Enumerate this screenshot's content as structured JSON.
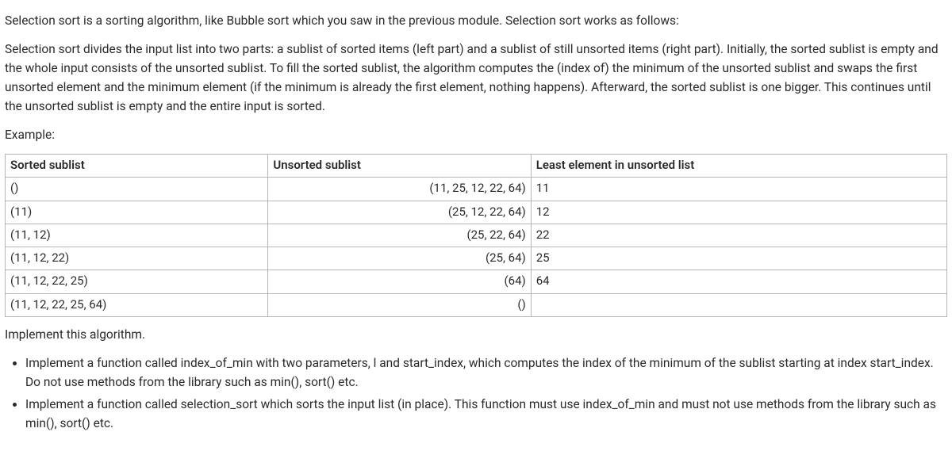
{
  "intro1": "Selection sort is a sorting algorithm, like Bubble sort which you saw in the previous module. Selection sort works as follows:",
  "intro2": "Selection sort divides the input list into two parts: a sublist of sorted items (left part) and a sublist of still unsorted items (right part). Initially, the sorted sublist is empty and the whole input consists of the unsorted sublist. To fill the sorted sublist, the algorithm computes the (index of) the minimum of the unsorted sublist and swaps the first unsorted element and the minimum element (if the minimum is already the first element, nothing happens). Afterward, the sorted sublist is one bigger. This continues until the unsorted sublist is empty and the entire input is sorted.",
  "example_label": "Example:",
  "table": {
    "headers": {
      "sorted": "Sorted sublist",
      "unsorted": "Unsorted sublist",
      "least": "Least element in unsorted list"
    },
    "rows": [
      {
        "sorted": "()",
        "unsorted": "(11, 25, 12, 22, 64)",
        "least": "11"
      },
      {
        "sorted": "(11)",
        "unsorted": "(25, 12, 22, 64)",
        "least": "12"
      },
      {
        "sorted": "(11, 12)",
        "unsorted": "(25, 22, 64)",
        "least": "22"
      },
      {
        "sorted": "(11, 12, 22)",
        "unsorted": "(25, 64)",
        "least": "25"
      },
      {
        "sorted": "(11, 12, 22, 25)",
        "unsorted": "(64)",
        "least": "64"
      },
      {
        "sorted": "(11, 12, 22, 25, 64)",
        "unsorted": "()",
        "least": ""
      }
    ]
  },
  "implement_line": "Implement this algorithm.",
  "bullets": [
    "Implement a function called index_of_min with two parameters, l and start_index, which computes the index of the minimum of the sublist starting at index start_index. Do not use methods from the library such as min(), sort() etc.",
    "Implement a function called selection_sort which sorts the input list (in place). This function must use index_of_min and must not use methods from the library such as min(), sort() etc."
  ]
}
